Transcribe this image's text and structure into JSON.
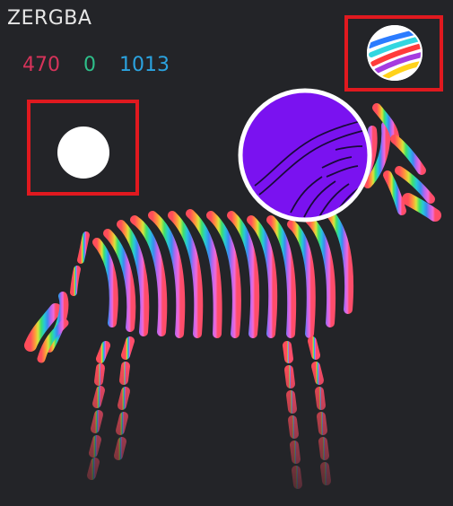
{
  "app": {
    "title": "ZERGBA"
  },
  "counters": {
    "red": "470",
    "green": "0",
    "blue": "1013"
  },
  "colors": {
    "background": "#232428",
    "red_counter": "#d6335a",
    "green_counter": "#2ebf8a",
    "blue_counter": "#2ba3e0",
    "highlight": "#e0191f",
    "magnifier_fill": "#7a12f0"
  },
  "icons": {
    "selected_color": "white-color-dot",
    "palette": "rainbow-ball-icon",
    "magnifier": "color-picker-loupe"
  }
}
